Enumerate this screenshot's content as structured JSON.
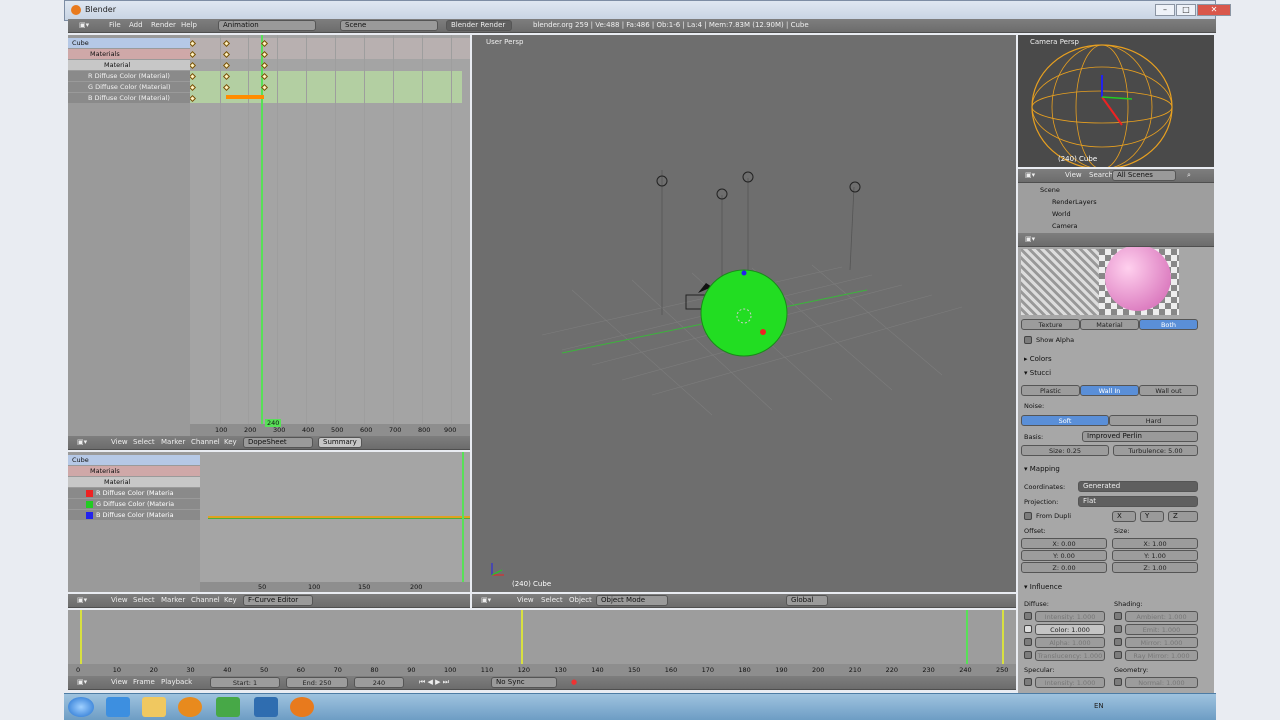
{
  "window": {
    "title": "Blender"
  },
  "menubar": {
    "items": [
      "File",
      "Add",
      "Render",
      "Help"
    ],
    "screen": "Animation",
    "scene": "Scene",
    "engine": "Blender Render",
    "info": "blender.org 259 | Ve:488 | Fa:486 | Ob:1-6 | La:4 | Mem:7.83M (12.90M) | Cube"
  },
  "dopesheet": {
    "channels": [
      "Cube",
      "Materials",
      "Material",
      "R Diffuse Color (Material)",
      "G Diffuse Color (Material)",
      "B Diffuse Color (Material)"
    ],
    "ruler": [
      "100",
      "200",
      "300",
      "400",
      "500",
      "600",
      "700",
      "800",
      "900"
    ],
    "current_frame": "240",
    "header": {
      "items": [
        "View",
        "Select",
        "Marker",
        "Channel",
        "Key"
      ],
      "mode": "DopeSheet",
      "summary": "Summary"
    }
  },
  "graph": {
    "channels": [
      "Cube",
      "Materials",
      "Material",
      "R Diffuse Color (Materia",
      "G Diffuse Color (Materia",
      "B Diffuse Color (Materia"
    ],
    "ruler": [
      "50",
      "100",
      "150",
      "200"
    ],
    "header": {
      "items": [
        "View",
        "Select",
        "Marker",
        "Channel",
        "Key"
      ],
      "mode": "F-Curve Editor"
    }
  },
  "viewport": {
    "label": "User Persp",
    "object_label": "(240) Cube",
    "header": {
      "items": [
        "View",
        "Select",
        "Object"
      ],
      "mode": "Object Mode",
      "orientation": "Global"
    }
  },
  "camera_view": {
    "label": "Camera Persp",
    "object_label": "(240) Cube"
  },
  "outliner": {
    "items": [
      "View",
      "Search"
    ],
    "filter": "All Scenes",
    "tree": [
      "Scene",
      "RenderLayers",
      "World",
      "Camera"
    ]
  },
  "properties": {
    "preview_tabs": [
      "Texture",
      "Material",
      "Both"
    ],
    "show_alpha": "Show Alpha",
    "colors": "Colors",
    "stucci": "Stucci",
    "stucci_types": [
      "Plastic",
      "Wall In",
      "Wall out"
    ],
    "noise_label": "Noise:",
    "noise_types": [
      "Soft",
      "Hard"
    ],
    "basis_label": "Basis:",
    "basis": "Improved Perlin",
    "size": "Size: 0.25",
    "turbulence": "Turbulence: 5.00",
    "mapping": "Mapping",
    "coordinates_label": "Coordinates:",
    "coordinates": "Generated",
    "projection_label": "Projection:",
    "projection": "Flat",
    "from_dupli": "From Dupli",
    "xyz": [
      "X",
      "Y",
      "Z"
    ],
    "offset_label": "Offset:",
    "offset": [
      "X: 0.00",
      "Y: 0.00",
      "Z: 0.00"
    ],
    "size_label": "Size:",
    "size_vals": [
      "X: 1.00",
      "Y: 1.00",
      "Z: 1.00"
    ],
    "influence": "Influence",
    "diffuse_label": "Diffuse:",
    "diffuse": [
      "Intensity: 1.000",
      "Color: 1.000",
      "Alpha: 1.000",
      "Translucency: 1.000"
    ],
    "shading_label": "Shading:",
    "shading": [
      "Ambient: 1.000",
      "Emit: 1.000",
      "Mirror: 1.000",
      "Ray Mirror: 1.000"
    ],
    "specular_label": "Specular:",
    "specular": [
      "Intensity: 1.000"
    ],
    "geometry_label": "Geometry:",
    "geometry": [
      "Normal: 1.000"
    ]
  },
  "timeline": {
    "ruler": [
      "0",
      "10",
      "20",
      "30",
      "40",
      "50",
      "60",
      "70",
      "80",
      "90",
      "100",
      "110",
      "120",
      "130",
      "140",
      "150",
      "160",
      "170",
      "180",
      "190",
      "200",
      "210",
      "220",
      "230",
      "240",
      "250"
    ],
    "header": {
      "items": [
        "View",
        "Frame",
        "Playback"
      ],
      "start": "Start: 1",
      "end": "End: 250",
      "current": "240",
      "sync": "No Sync"
    }
  },
  "taskbar": {
    "tray": "EN"
  },
  "colors": {
    "accent": "#5a8fd8",
    "keyframe_selected": "#ff8c00",
    "cursor_green": "#57e057",
    "sphere": "#22dd22"
  }
}
